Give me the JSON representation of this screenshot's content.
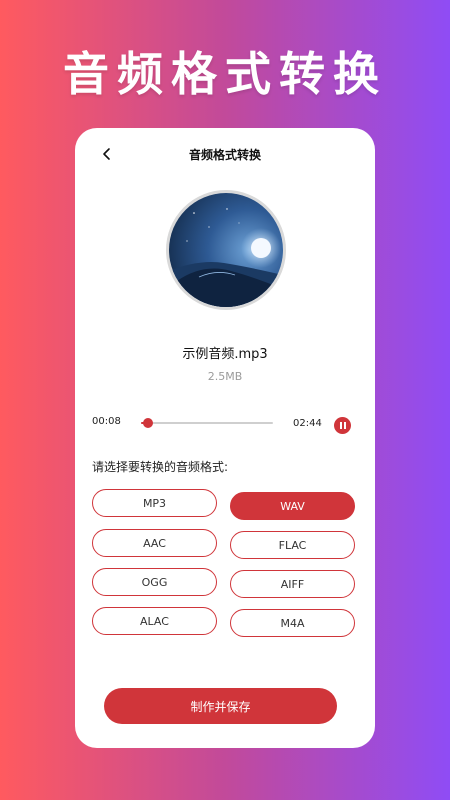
{
  "promo": {
    "title": "音频格式转换"
  },
  "header": {
    "title": "音频格式转换",
    "back_icon": "chevron-left-icon"
  },
  "file": {
    "name": "示例音频.mp3",
    "size": "2.5MB"
  },
  "player": {
    "current_time": "00:08",
    "total_time": "02:44",
    "progress": 0.05,
    "state": "playing",
    "control_icon": "pause-icon"
  },
  "formats": {
    "prompt": "请选择要转换的音频格式:",
    "options": [
      "MP3",
      "WAV",
      "AAC",
      "FLAC",
      "OGG",
      "AIFF",
      "ALAC",
      "M4A"
    ],
    "selected": "WAV"
  },
  "actions": {
    "save_label": "制作并保存"
  },
  "colors": {
    "accent": "#d0353a",
    "gradient_start": "#ff5a5f",
    "gradient_end": "#8f4cf5"
  }
}
